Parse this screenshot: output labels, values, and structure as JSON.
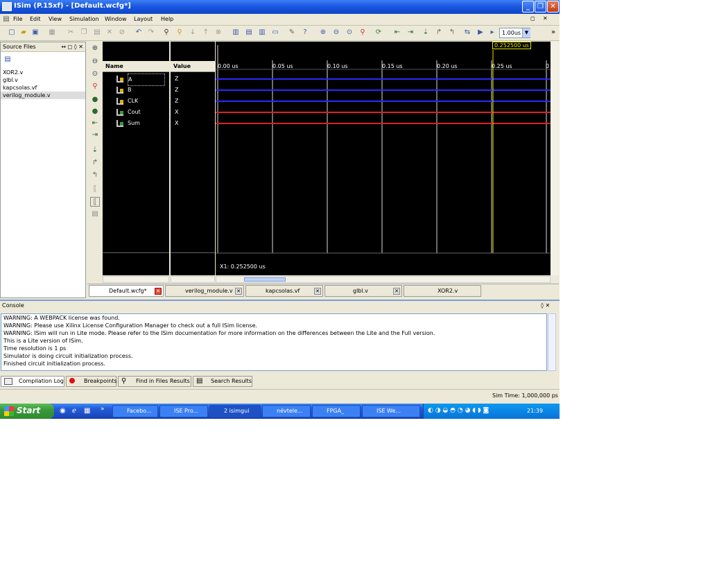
{
  "window": {
    "title": "ISim (P.15xf) - [Default.wcfg*]",
    "min": "_",
    "max": "❐",
    "close": "✕"
  },
  "menu": [
    "File",
    "Edit",
    "View",
    "Simulation",
    "Window",
    "Layout",
    "Help"
  ],
  "toolbar": {
    "zoom_value": "1.00us",
    "overflow": "»"
  },
  "source_panel": {
    "title": "Source Files",
    "controls": "↔ ◻ ◊ ✕",
    "files": [
      "XOR2.v",
      "glbl.v",
      "kapcsolas.vf",
      "verilog_module.v"
    ]
  },
  "wave": {
    "name_header": "Name",
    "value_header": "Value",
    "signals": [
      {
        "name": "A",
        "value": "Z",
        "dir": "in"
      },
      {
        "name": "B",
        "value": "Z",
        "dir": "in"
      },
      {
        "name": "CLK",
        "value": "Z",
        "dir": "in"
      },
      {
        "name": "Cout",
        "value": "X",
        "dir": "out"
      },
      {
        "name": "Sum",
        "value": "X",
        "dir": "out"
      }
    ],
    "time_ticks": [
      "0.00 us",
      "0.05 us",
      "0.10 us",
      "0.15 us",
      "0.20 us",
      "0.25 us",
      "0"
    ],
    "cursor_label": "0.252500 us",
    "x1_label": "X1: 0.252500 us"
  },
  "doc_tabs": [
    {
      "label": "Default.wcfg*",
      "active": true
    },
    {
      "label": "verilog_module.v"
    },
    {
      "label": "kapcsolas.vf"
    },
    {
      "label": "glbl.v"
    },
    {
      "label": "XOR2.v"
    }
  ],
  "console": {
    "title": "Console",
    "controls": "◊ ✕",
    "lines": [
      "WARNING: A WEBPACK license was found.",
      "WARNING: Please use Xilinx License Configuration Manager to check out a full ISim license.",
      "WARNING: ISim will run in Lite mode. Please refer to the ISim documentation for more information on the differences between the Lite and the Full version.",
      "This is a Lite version of ISim.",
      "Time resolution is 1 ps",
      "Simulator is doing circuit initialization process.",
      "Finished circuit initialization process."
    ]
  },
  "bottom_tabs": [
    "Compilation Log",
    "Breakpoints",
    "Find in Files Results",
    "Search Results"
  ],
  "status": {
    "sim_time": "Sim Time: 1,000,000 ps"
  },
  "taskbar": {
    "start": "Start",
    "buttons": [
      "Facebo...",
      "ISE Pro...",
      "2 isimgui",
      "névtele...",
      "FPGA_",
      "ISE We..."
    ],
    "clock": "21:39"
  }
}
